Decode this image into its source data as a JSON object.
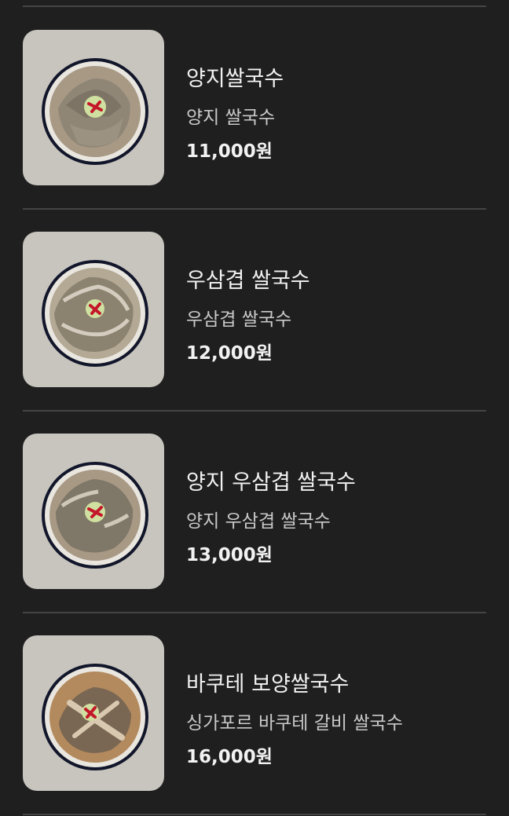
{
  "menu": {
    "items": [
      {
        "name": "양지쌀국수",
        "description": "양지 쌀국수",
        "price": "11,000원"
      },
      {
        "name": "우삼겹 쌀국수",
        "description": "우삼겹 쌀국수",
        "price": "12,000원"
      },
      {
        "name": "양지 우삼겹 쌀국수",
        "description": "양지 우삼겹 쌀국수",
        "price": "13,000원"
      },
      {
        "name": "바쿠테 보양쌀국수",
        "description": "싱가포르 바쿠테 갈비 쌀국수",
        "price": "16,000원"
      }
    ]
  },
  "colors": {
    "background": "#1f1f1f",
    "divider": "#444444",
    "thumbnail_bg": "#c8c5bf",
    "bowl_rim": "#1e2440"
  }
}
